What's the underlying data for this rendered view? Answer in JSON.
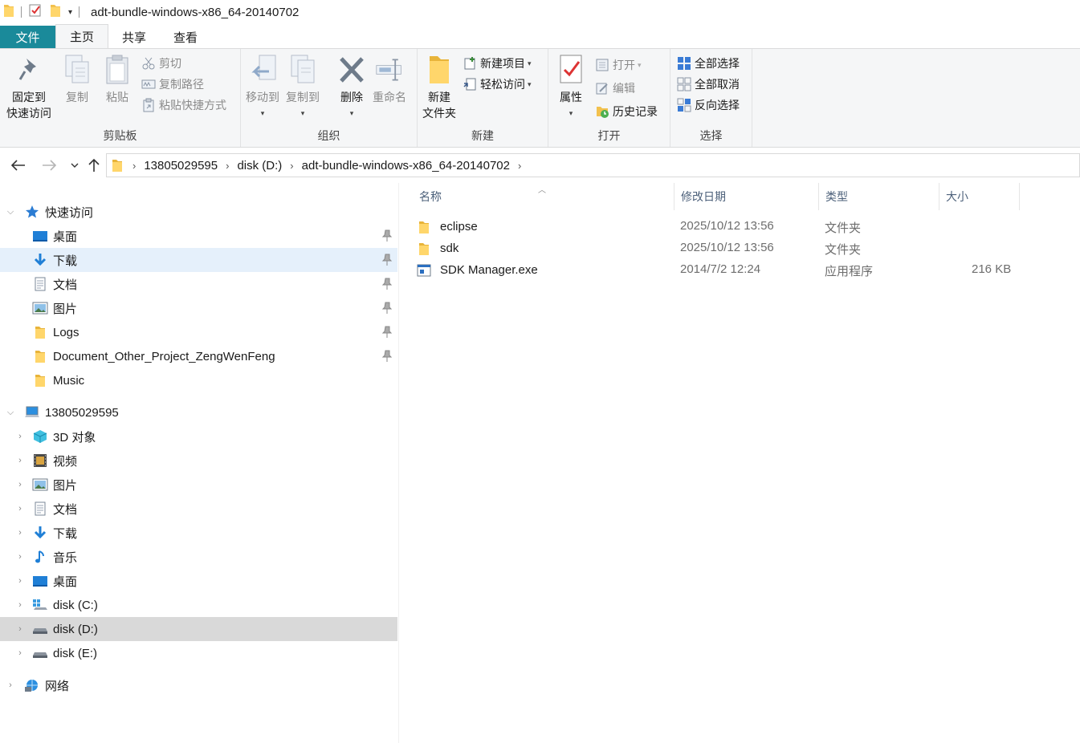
{
  "window": {
    "title": "adt-bundle-windows-x86_64-20140702"
  },
  "tabs": {
    "file": "文件",
    "home": "主页",
    "share": "共享",
    "view": "查看"
  },
  "ribbon": {
    "clipboard": {
      "label": "剪贴板",
      "pin": "固定到\n快速访问",
      "pin_line1": "固定到",
      "pin_line2": "快速访问",
      "copy": "复制",
      "paste": "粘贴",
      "cut": "剪切",
      "copy_path": "复制路径",
      "paste_shortcut": "粘贴快捷方式"
    },
    "organize": {
      "label": "组织",
      "move_to": "移动到",
      "copy_to": "复制到",
      "delete": "删除",
      "rename": "重命名"
    },
    "new": {
      "label": "新建",
      "new_folder_line1": "新建",
      "new_folder_line2": "文件夹",
      "new_item": "新建项目",
      "easy_access": "轻松访问"
    },
    "open": {
      "label": "打开",
      "properties": "属性",
      "open": "打开",
      "edit": "编辑",
      "history": "历史记录"
    },
    "select": {
      "label": "选择",
      "select_all": "全部选择",
      "select_none": "全部取消",
      "invert": "反向选择"
    }
  },
  "address": {
    "crumbs": [
      "13805029595",
      "disk (D:)",
      "adt-bundle-windows-x86_64-20140702"
    ]
  },
  "nav": {
    "quick_access": "快速访问",
    "quick_items": [
      {
        "label": "桌面",
        "icon": "desktop-icon"
      },
      {
        "label": "下载",
        "icon": "download-icon"
      },
      {
        "label": "文档",
        "icon": "document-icon"
      },
      {
        "label": "图片",
        "icon": "picture-icon"
      },
      {
        "label": "Logs",
        "icon": "folder-icon"
      },
      {
        "label": "Document_Other_Project_ZengWenFeng",
        "icon": "folder-icon"
      },
      {
        "label": "Music",
        "icon": "folder-icon"
      }
    ],
    "this_pc": "13805029595",
    "pc_items": [
      {
        "label": "3D 对象",
        "icon": "3d-objects-icon"
      },
      {
        "label": "视频",
        "icon": "video-icon"
      },
      {
        "label": "图片",
        "icon": "picture-icon"
      },
      {
        "label": "文档",
        "icon": "document-icon"
      },
      {
        "label": "下载",
        "icon": "download-icon"
      },
      {
        "label": "音乐",
        "icon": "music-icon"
      },
      {
        "label": "桌面",
        "icon": "desktop-icon"
      },
      {
        "label": "disk (C:)",
        "icon": "system-drive-icon"
      },
      {
        "label": "disk (D:)",
        "icon": "drive-icon"
      },
      {
        "label": "disk (E:)",
        "icon": "drive-icon"
      }
    ],
    "network": "网络"
  },
  "list": {
    "columns": {
      "name": "名称",
      "modified": "修改日期",
      "type": "类型",
      "size": "大小"
    },
    "rows": [
      {
        "name": "eclipse",
        "modified": "2025/10/12 13:56",
        "type": "文件夹",
        "size": ""
      },
      {
        "name": "sdk",
        "modified": "2025/10/12 13:56",
        "type": "文件夹",
        "size": ""
      },
      {
        "name": "SDK Manager.exe",
        "modified": "2014/7/2 12:24",
        "type": "应用程序",
        "size": "216 KB"
      }
    ]
  }
}
